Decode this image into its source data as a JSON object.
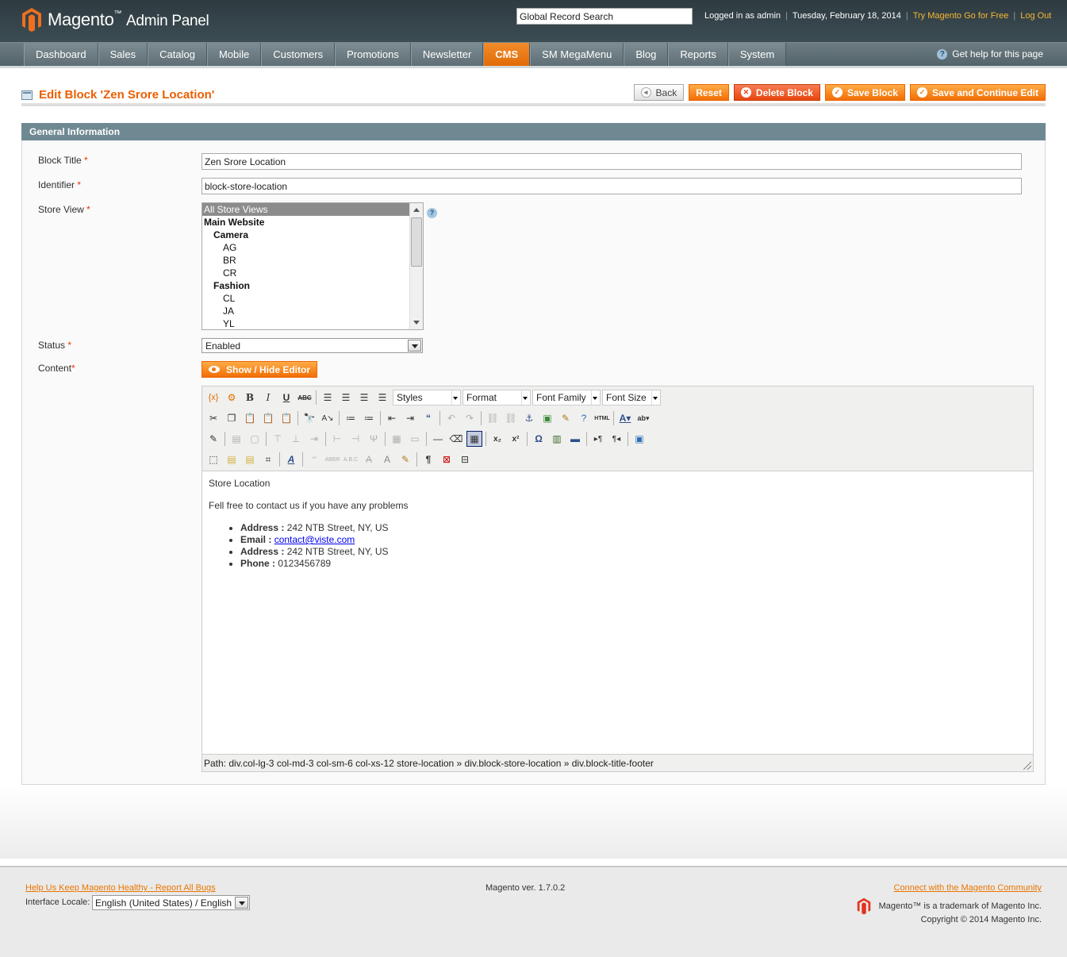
{
  "header": {
    "logo_brand": "Magento",
    "logo_tm": "™",
    "logo_sub": "Admin Panel",
    "search_value": "Global Record Search",
    "logged_in": "Logged in as admin",
    "date": "Tuesday, February 18, 2014",
    "try_link": "Try Magento Go for Free",
    "logout_link": "Log Out"
  },
  "nav": {
    "items": [
      "Dashboard",
      "Sales",
      "Catalog",
      "Mobile",
      "Customers",
      "Promotions",
      "Newsletter",
      "CMS",
      "SM MegaMenu",
      "Blog",
      "Reports",
      "System"
    ],
    "active": "CMS",
    "help": "Get help for this page"
  },
  "page": {
    "title": "Edit Block 'Zen Srore Location'",
    "buttons": {
      "back": "Back",
      "reset": "Reset",
      "delete": "Delete Block",
      "save": "Save Block",
      "save_continue": "Save and Continue Edit"
    }
  },
  "form": {
    "section_title": "General Information",
    "required_mark": "*",
    "block_title_label": "Block Title",
    "block_title_value": "Zen Srore Location",
    "identifier_label": "Identifier",
    "identifier_value": "block-store-location",
    "store_view_label": "Store View",
    "store_views": [
      {
        "text": "All Store Views",
        "level": "top",
        "selected": true
      },
      {
        "text": "Main Website",
        "level": "group"
      },
      {
        "text": "Camera",
        "level": "sub"
      },
      {
        "text": "AG",
        "level": "leaf"
      },
      {
        "text": "BR",
        "level": "leaf"
      },
      {
        "text": "CR",
        "level": "leaf"
      },
      {
        "text": "Fashion",
        "level": "sub"
      },
      {
        "text": "CL",
        "level": "leaf"
      },
      {
        "text": "JA",
        "level": "leaf"
      },
      {
        "text": "YL",
        "level": "leaf"
      }
    ],
    "status_label": "Status",
    "status_value": "Enabled",
    "content_label": "Content",
    "toggle_editor": "Show / Hide Editor"
  },
  "editor": {
    "selects": [
      "Styles",
      "Format",
      "Font Family",
      "Font Size"
    ],
    "content": {
      "heading": "Store Location",
      "intro": "Fell free to contact us if you have any problems",
      "items": [
        {
          "key": "Address :",
          "value": " 242 NTB Street, NY, US"
        },
        {
          "key": "Email :",
          "link": "contact@viste.com"
        },
        {
          "key": "Address :",
          "value": " 242 NTB Street, NY, US"
        },
        {
          "key": "Phone :",
          "value": " 0123456789"
        }
      ]
    },
    "path": "Path: div.col-lg-3 col-md-3 col-sm-6 col-xs-12 store-location » div.block-store-location » div.block-title-footer"
  },
  "footer": {
    "help_link": "Help Us Keep Magento Healthy - Report All Bugs",
    "locale_label": "Interface Locale:",
    "locale_value": "English (United States) / English",
    "version": "Magento ver. 1.7.0.2",
    "community_link": "Connect with the Magento Community",
    "trademark": "Magento™ is a trademark of Magento Inc.",
    "copyright": "Copyright © 2014 Magento Inc."
  },
  "colors": {
    "accent": "#eb5e00",
    "header_bg": "#2e3b40",
    "nav_active": "#e06a06",
    "section_head": "#6f8992"
  }
}
